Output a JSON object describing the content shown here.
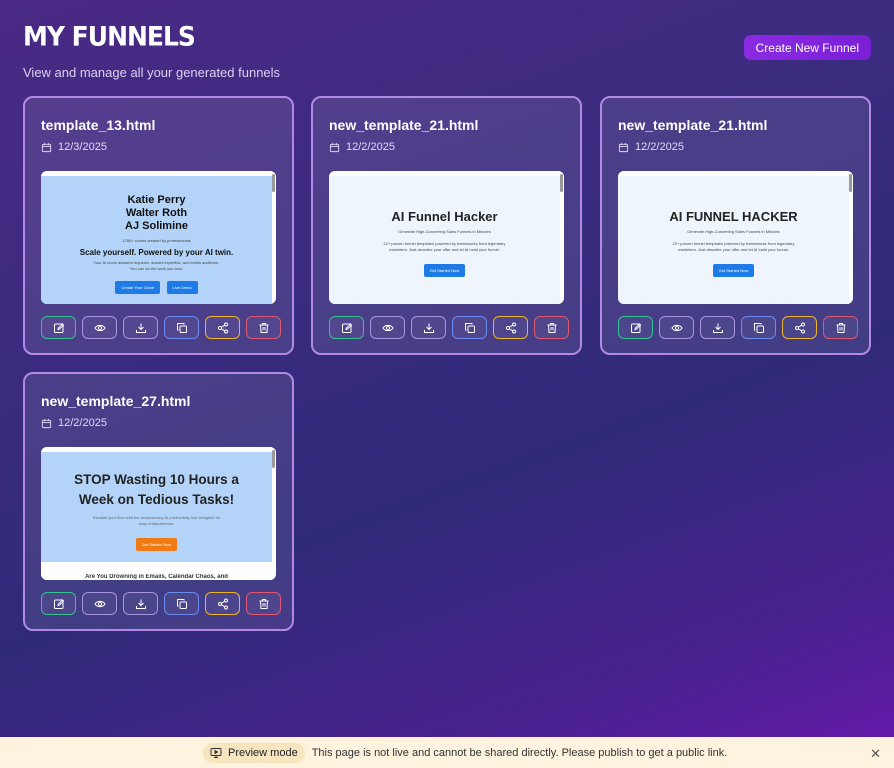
{
  "header": {
    "title": "MY FUNNELS",
    "subtitle": "View and manage all your generated funnels",
    "create_button": "Create New Funnel"
  },
  "funnels": [
    {
      "name": "template_13.html",
      "date": "12/3/2025",
      "preview": {
        "lines": [
          "Katie Perry",
          "Walter Roth",
          "AJ Solimine"
        ],
        "sub": "1250+ clones created by professionals",
        "heading": "Scale yourself. Powered by your AI twin.",
        "desc1": "Your AI clone answers inquiries, shares expertise, and builds audience.",
        "desc2": "You can do the work you love.",
        "btn1": "Create Your Clone",
        "btn2": "Live Demo"
      }
    },
    {
      "name": "new_template_21.html",
      "date": "12/2/2025",
      "preview": {
        "title": "AI Funnel Hacker",
        "sub": "Generate High-Converting Sales Funnels in Minutes",
        "desc1": "22+ proven funnel templates powered by frameworks from legendary",
        "desc2": "marketers. Just describe your offer and let AI build your funnel.",
        "btn": "Get Started Now"
      }
    },
    {
      "name": "new_template_21.html",
      "date": "12/2/2025",
      "preview": {
        "title": "AI FUNNEL HACKER",
        "sub": "Generate High-Converting Sales Funnels in Minutes",
        "desc1": "22+ proven funnel templates powered by frameworks from legendary",
        "desc2": "marketers. Just describe your offer and let AI build your funnel.",
        "btn": "Get Started Now"
      }
    },
    {
      "name": "new_template_27.html",
      "date": "12/2/2025",
      "preview": {
        "title1": "STOP Wasting 10 Hours a",
        "title2": "Week on Tedious Tasks!",
        "desc1": "Reclaim your time with the revolutionary AI productivity tool designed for",
        "desc2": "busy entrepreneurs.",
        "btn": "Get Started Now",
        "footer": "Are You Drowning in Emails, Calendar Chaos, and"
      }
    }
  ],
  "banner": {
    "label": "Preview mode",
    "message": "This page is not live and cannot be shared directly. Please publish to get a public link.",
    "close": "✕"
  },
  "icons": [
    "edit-icon",
    "eye-icon",
    "download-icon",
    "copy-icon",
    "share-icon",
    "trash-icon"
  ],
  "colors": {
    "accent": "#8a2be2",
    "card_border": "#b28ae6",
    "edit": "#34c38f",
    "share": "#f0b429",
    "delete": "#e0566e"
  }
}
